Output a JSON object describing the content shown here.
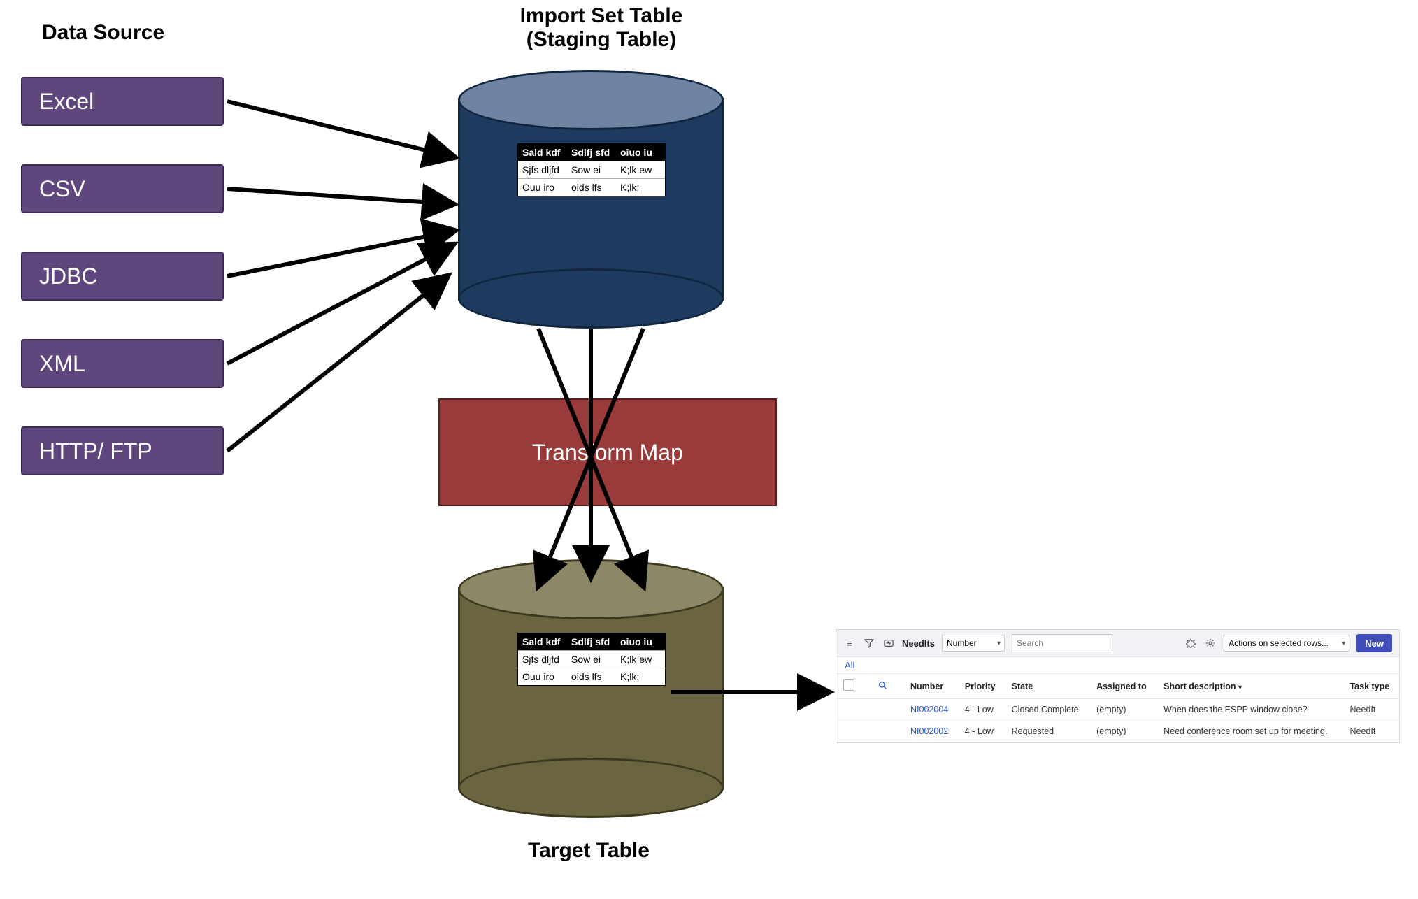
{
  "headings": {
    "dataSource": "Data Source",
    "importSetLine1": "Import Set Table",
    "importSetLine2": "(Staging Table)",
    "targetTable": "Target Table"
  },
  "sources": [
    "Excel",
    "CSV",
    "JDBC",
    "XML",
    "HTTP/ FTP"
  ],
  "transform": {
    "label": "Transform Map"
  },
  "miniTable": {
    "headers": [
      "Sald kdf",
      "Sdlfj sfd",
      "oiuo iu"
    ],
    "rows": [
      [
        "Sjfs dljfd",
        "Sow ei",
        "K;lk ew"
      ],
      [
        "Ouu iro",
        "oids lfs",
        "K;lk;"
      ]
    ]
  },
  "listView": {
    "title": "NeedIts",
    "searchField": "Number",
    "searchPlaceholder": "Search",
    "actionsLabel": "Actions on selected rows...",
    "newLabel": "New",
    "allFilter": "All",
    "columns": [
      "Number",
      "Priority",
      "State",
      "Assigned to",
      "Short description",
      "Task type"
    ],
    "sortIndicatorColumn": 4,
    "rows": [
      {
        "number": "NI002004",
        "priority": "4 - Low",
        "state": "Closed Complete",
        "assigned": "(empty)",
        "desc": "When does the ESPP window close?",
        "task": "NeedIt"
      },
      {
        "number": "NI002002",
        "priority": "4 - Low",
        "state": "Requested",
        "assigned": "(empty)",
        "desc": "Need conference room set up for meeting.",
        "task": "NeedIt"
      }
    ]
  }
}
